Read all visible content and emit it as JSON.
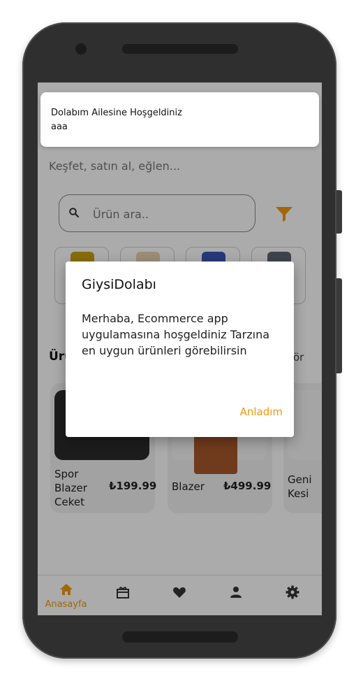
{
  "toast": {
    "title": "Dolabım Ailesine Hoşgeldiniz",
    "message": "aaa"
  },
  "home": {
    "subtitle": "Keşfet, satın al, eğlen...",
    "search_placeholder": "Ürün ara..",
    "section_title_partial": "Ürü",
    "section_action_partial": "ör",
    "products": [
      {
        "name": "Spor\nBlazer\nCeket",
        "price": "₺199.99"
      },
      {
        "name": "Blazer",
        "price": "₺499.99"
      },
      {
        "name": "Geni\nKesi",
        "price": ""
      }
    ]
  },
  "dialog": {
    "title": "GiysiDolabı",
    "message": "Merhaba, Ecommerce app uygulamasına hoşgeldiniz Tarzına en uygun ürünleri görebilirsin",
    "ok_label": "Anladım"
  },
  "nav": {
    "active": "home",
    "items": [
      {
        "id": "home",
        "label": "Anasayfa",
        "icon": "home-icon"
      },
      {
        "id": "gifts",
        "label": "",
        "icon": "gift-icon"
      },
      {
        "id": "favorites",
        "label": "",
        "icon": "heart-icon"
      },
      {
        "id": "profile",
        "label": "",
        "icon": "person-icon"
      },
      {
        "id": "settings",
        "label": "",
        "icon": "gear-icon"
      }
    ]
  },
  "colors": {
    "accent": "#f09a0f",
    "nav_inactive": "#333333"
  }
}
